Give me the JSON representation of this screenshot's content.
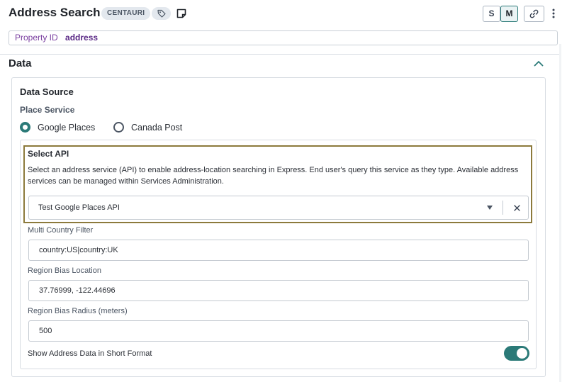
{
  "header": {
    "title": "Address Search",
    "badge": "CENTAURI",
    "size_small": "S",
    "size_medium": "M"
  },
  "property": {
    "label": "Property ID",
    "value": "address"
  },
  "section": {
    "title": "Data"
  },
  "data_source": {
    "title": "Data Source",
    "place_service_label": "Place Service",
    "options": [
      {
        "label": "Google Places",
        "selected": true
      },
      {
        "label": "Canada Post",
        "selected": false
      }
    ]
  },
  "select_api": {
    "title": "Select API",
    "description": "Select an address service (API) to enable address-location searching in Express. End user's query this service as they type. Available address services can be managed within Services Administration.",
    "selected_value": "Test Google Places API"
  },
  "fields": {
    "multi_country_label": "Multi Country Filter",
    "multi_country_value": "country:US|country:UK",
    "region_bias_location_label": "Region Bias Location",
    "region_bias_location_value": "37.76999, -122.44696",
    "region_bias_radius_label": "Region Bias Radius (meters)",
    "region_bias_radius_value": "500"
  },
  "short_format": {
    "label": "Show Address Data in Short Format",
    "enabled": true
  },
  "icons": {
    "tag": "tag-icon",
    "note": "note-icon",
    "link": "link-icon",
    "more": "kebab-menu-icon",
    "collapse": "chevron-up-icon",
    "dropdown": "caret-down-icon",
    "clear": "close-icon"
  },
  "colors": {
    "accent": "#2b7a78",
    "property_label": "#7a3fa0",
    "highlight_border": "#8c7a3c"
  }
}
